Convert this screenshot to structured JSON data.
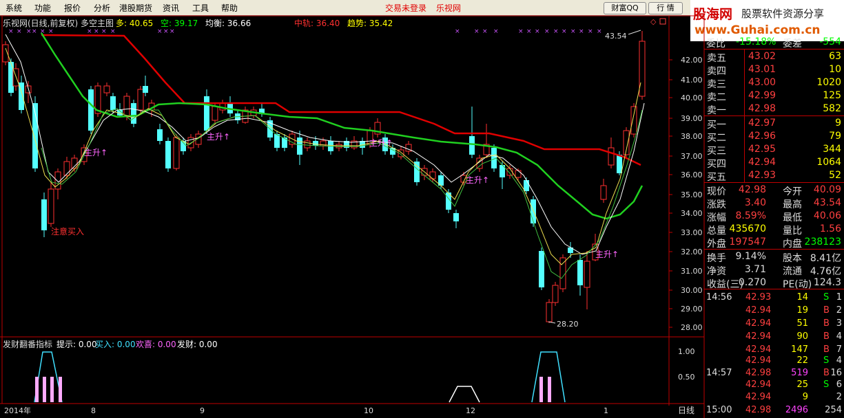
{
  "menu": [
    "系统",
    "功能",
    "报价",
    "分析",
    "港股期货",
    "资讯",
    "工具",
    "帮助"
  ],
  "status": {
    "login": "交易未登录",
    "site": "乐视网"
  },
  "buttons": {
    "caifu": "财富QQ",
    "hangqing": "行 情"
  },
  "logo": {
    "cn": "股海网",
    "slogan": "股票软件资源分享",
    "url": "www.Guhai.com.cn"
  },
  "main_chart": {
    "title": "乐视网(日线,前复权) 多空主图",
    "indicators": [
      {
        "label": "多: 40.65",
        "color": "#ffff00"
      },
      {
        "label": "空: 39.17",
        "color": "#00ff00"
      },
      {
        "label": "均衡: 36.66",
        "color": "#ffffff"
      },
      {
        "label": "中轨: 36.40",
        "color": "#ff3030"
      },
      {
        "label": "趋势: 35.42",
        "color": "#ffff00"
      }
    ],
    "annotations": {
      "buy": "注意买入",
      "rise": "主升↑",
      "high": "43.54",
      "low": "28.20"
    },
    "y_ticks": [
      "42.00",
      "41.00",
      "40.00",
      "39.00",
      "38.00",
      "37.00",
      "36.00",
      "35.00",
      "34.00",
      "33.00",
      "32.00",
      "31.00",
      "30.00",
      "29.00",
      "28.00"
    ]
  },
  "sub_chart": {
    "title": "发财翻番指标",
    "values": [
      {
        "label": "提示: 0.00",
        "color": "#ffffff"
      },
      {
        "label": "买入: 0.00",
        "color": "#40e0ff"
      },
      {
        "label": "欢喜: 0.00",
        "color": "#ff66ff"
      },
      {
        "label": "发财: 0.00",
        "color": "#ffffff"
      }
    ],
    "y_ticks": [
      "1.00",
      "0.50"
    ]
  },
  "x_axis": {
    "labels": [
      "2014年",
      "8",
      "9",
      "10",
      "12",
      "1"
    ],
    "period": "日线"
  },
  "quote": {
    "weibi": {
      "label": "委比",
      "value": "-15.18%",
      "label2": "委差",
      "value2": "-554"
    },
    "asks": [
      {
        "label": "卖五",
        "price": "43.02",
        "vol": "63"
      },
      {
        "label": "卖四",
        "price": "43.01",
        "vol": "10"
      },
      {
        "label": "卖三",
        "price": "43.00",
        "vol": "1020"
      },
      {
        "label": "卖二",
        "price": "42.99",
        "vol": "125"
      },
      {
        "label": "卖一",
        "price": "42.98",
        "vol": "582"
      }
    ],
    "bids": [
      {
        "label": "买一",
        "price": "42.97",
        "vol": "9"
      },
      {
        "label": "买二",
        "price": "42.96",
        "vol": "79"
      },
      {
        "label": "买三",
        "price": "42.95",
        "vol": "344"
      },
      {
        "label": "买四",
        "price": "42.94",
        "vol": "1064"
      },
      {
        "label": "买五",
        "price": "42.93",
        "vol": "52"
      }
    ],
    "stats": [
      {
        "l1": "现价",
        "v1": "42.98",
        "l2": "今开",
        "v2": "40.09",
        "c1": "#ff4040",
        "c2": "#ff4040"
      },
      {
        "l1": "涨跌",
        "v1": "3.40",
        "l2": "最高",
        "v2": "43.54",
        "c1": "#ff4040",
        "c2": "#ff4040"
      },
      {
        "l1": "涨幅",
        "v1": "8.59%",
        "l2": "最低",
        "v2": "40.06",
        "c1": "#ff4040",
        "c2": "#ff4040"
      },
      {
        "l1": "总量",
        "v1": "435670",
        "l2": "量比",
        "v2": "1.56",
        "c1": "#ffff00",
        "c2": "#ff4040"
      },
      {
        "l1": "外盘",
        "v1": "197547",
        "l2": "内盘",
        "v2": "238123",
        "c1": "#ff4040",
        "c2": "#00ff00"
      }
    ],
    "fund": [
      {
        "l1": "换手",
        "v1": "9.14%",
        "l2": "股本",
        "v2": "8.41亿"
      },
      {
        "l1": "净资",
        "v1": "3.71",
        "l2": "流通",
        "v2": "4.76亿"
      },
      {
        "l1": "收益(三)",
        "v1": "0.270",
        "l2": "PE(动)",
        "v2": "124.3"
      }
    ]
  },
  "ticks": [
    {
      "time": "14:56",
      "price": "42.93",
      "vol": "14",
      "side": "S",
      "n": "1"
    },
    {
      "time": "",
      "price": "42.94",
      "vol": "19",
      "side": "B",
      "n": "2"
    },
    {
      "time": "",
      "price": "42.94",
      "vol": "51",
      "side": "B",
      "n": "3"
    },
    {
      "time": "",
      "price": "42.94",
      "vol": "90",
      "side": "B",
      "n": "4"
    },
    {
      "time": "",
      "price": "42.94",
      "vol": "147",
      "side": "B",
      "n": "7"
    },
    {
      "time": "",
      "price": "42.94",
      "vol": "22",
      "side": "S",
      "n": "4"
    },
    {
      "time": "14:57",
      "price": "42.98",
      "vol": "519",
      "side": "B",
      "n": "16"
    },
    {
      "time": "",
      "price": "42.94",
      "vol": "25",
      "side": "S",
      "n": "6"
    },
    {
      "time": "",
      "price": "42.94",
      "vol": "9",
      "side": "",
      "n": "2"
    },
    {
      "time": "15:00",
      "price": "42.98",
      "vol": "2496",
      "side": "",
      "n": "254"
    }
  ]
}
